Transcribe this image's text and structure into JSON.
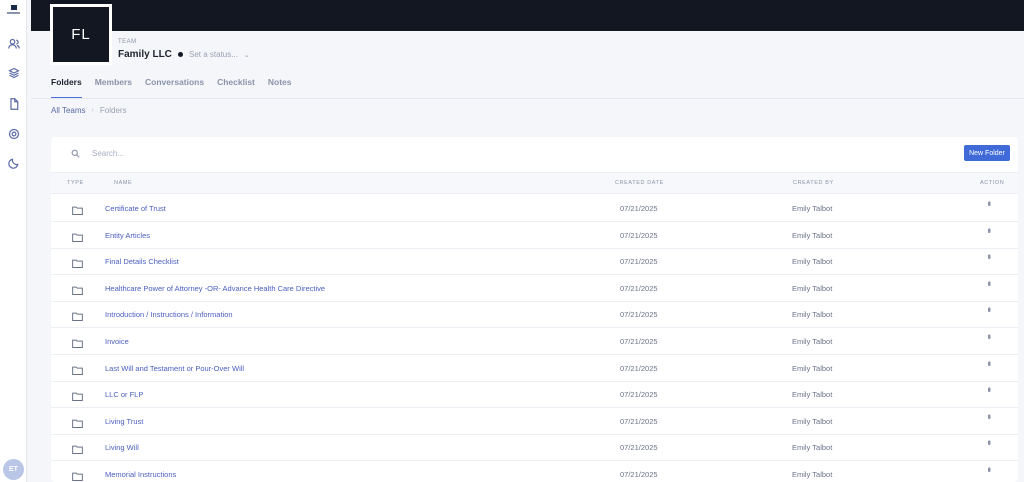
{
  "sidebar": {
    "icons": [
      "users-icon",
      "layers-icon",
      "document-icon",
      "support-icon",
      "moon-icon"
    ],
    "avatar_initials": "ET"
  },
  "team": {
    "initials": "FL",
    "label": "TEAM",
    "name": "Family LLC",
    "status_placeholder": "Set a status..."
  },
  "tabs": [
    {
      "label": "Folders",
      "active": true
    },
    {
      "label": "Members",
      "active": false
    },
    {
      "label": "Conversations",
      "active": false
    },
    {
      "label": "Checklist",
      "active": false
    },
    {
      "label": "Notes",
      "active": false
    }
  ],
  "breadcrumb": {
    "root": "All Teams",
    "separator": "›",
    "current": "Folders"
  },
  "toolbar": {
    "search_placeholder": "Search...",
    "new_folder_label": "New Folder"
  },
  "table": {
    "headers": {
      "type": "TYPE",
      "name": "NAME",
      "created_date": "CREATED DATE",
      "created_by": "CREATED BY",
      "action": "ACTION"
    },
    "rows": [
      {
        "name": "Certificate of Trust",
        "date": "07/21/2025",
        "by": "Emily Talbot"
      },
      {
        "name": "Entity Articles",
        "date": "07/21/2025",
        "by": "Emily Talbot"
      },
      {
        "name": "Final Details Checklist",
        "date": "07/21/2025",
        "by": "Emily Talbot"
      },
      {
        "name": "Healthcare Power of Attorney -OR- Advance Health Care Directive",
        "date": "07/21/2025",
        "by": "Emily Talbot"
      },
      {
        "name": "Introduction / Instructions / Information",
        "date": "07/21/2025",
        "by": "Emily Talbot"
      },
      {
        "name": "Invoice",
        "date": "07/21/2025",
        "by": "Emily Talbot"
      },
      {
        "name": "Last Will and Testament or Pour-Over Will",
        "date": "07/21/2025",
        "by": "Emily Talbot"
      },
      {
        "name": "LLC or FLP",
        "date": "07/21/2025",
        "by": "Emily Talbot"
      },
      {
        "name": "Living Trust",
        "date": "07/21/2025",
        "by": "Emily Talbot"
      },
      {
        "name": "Living Will",
        "date": "07/21/2025",
        "by": "Emily Talbot"
      },
      {
        "name": "Memorial Instructions",
        "date": "07/21/2025",
        "by": "Emily Talbot"
      }
    ]
  },
  "colors": {
    "accent": "#3f6ad8",
    "link": "#4a5ec0",
    "topbar": "#131722"
  }
}
